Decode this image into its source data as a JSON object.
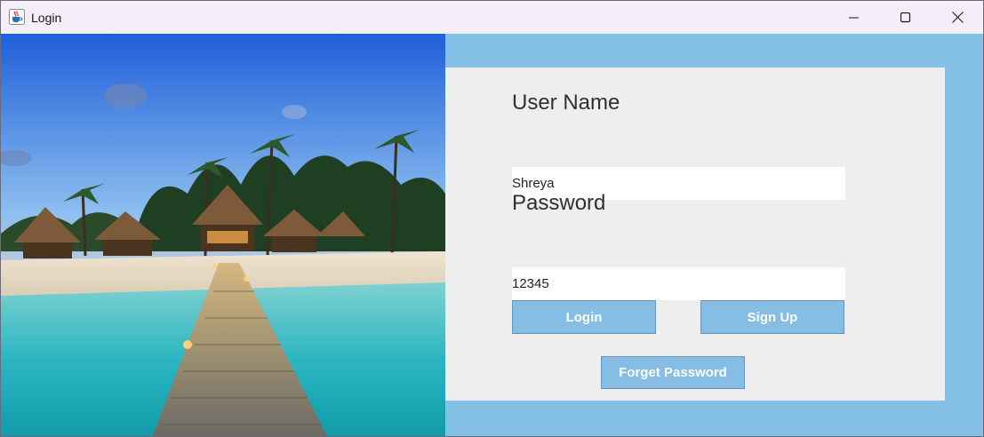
{
  "window": {
    "title": "Login",
    "icon": "java-cup-icon",
    "controls": [
      "minimize-icon",
      "maximize-icon",
      "close-icon"
    ]
  },
  "photo": {
    "subject": "tropical-beach-resort-image"
  },
  "form": {
    "username_label": "User Name",
    "username_value": "Shreya",
    "password_label": "Password",
    "password_value": "12345",
    "login_label": "Login",
    "signup_label": "Sign Up",
    "forget_label": "Forget Password"
  },
  "colors": {
    "background": "#85c0e6",
    "card": "#eeeeee",
    "button": "#85bde4",
    "button_text": "#ffffff"
  }
}
